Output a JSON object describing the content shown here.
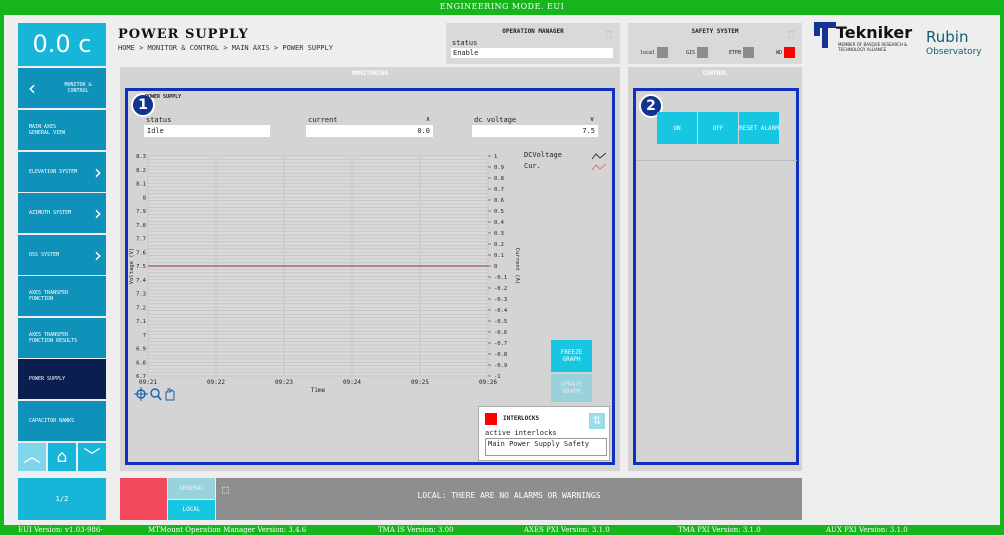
{
  "header_bar": "ENGINEERING MODE. EUI",
  "temperature": "0.0 c",
  "title": "POWER SUPPLY",
  "breadcrumb": "HOME > MONITOR & CONTROL > MAIN AXIS > POWER SUPPLY",
  "operation_manager": {
    "title": "OPERATION MANAGER",
    "status_label": "status",
    "status_value": "Enable"
  },
  "safety_system": {
    "title": "SAFETY SYSTEM",
    "local": "local",
    "gis": "GIS",
    "etpb": "ETPB",
    "wd": "WD"
  },
  "logo": {
    "tekniker": "Tekniker",
    "tekniker_sub": "MEMBER OF BASQUE RESEARCH & TECHNOLOGY ALLIANCE",
    "rubin": "Rubin",
    "observatory": "Observatory"
  },
  "sidebar": {
    "back_label": "MONITOR & CONTROL",
    "items": [
      {
        "label": "MAIN AXES GENERAL VIEW",
        "chevron": false
      },
      {
        "label": "ELEVATION SYSTEM",
        "chevron": true
      },
      {
        "label": "AZIMUTH SYSTEM",
        "chevron": true
      },
      {
        "label": "OSS SYSTEM",
        "chevron": true
      },
      {
        "label": "AXES TRANSFER FUNCTION",
        "chevron": false
      },
      {
        "label": "AXES TRANSFER FUNCTION RESULTS",
        "chevron": false
      },
      {
        "label": "POWER SUPPLY",
        "chevron": false,
        "active": true
      },
      {
        "label": "CAPACITOR BANKS",
        "chevron": false
      }
    ],
    "page": "1/2"
  },
  "monitoring": {
    "title": "MONITORING",
    "badge": "1",
    "panel_title": "POWER SUPPLY",
    "status_label": "status",
    "status_value": "Idle",
    "current_label": "current",
    "current_value": "0.0",
    "voltage_label": "dc voltage",
    "voltage_value": "7.5",
    "freeze_label": "FREEZE GRAPH",
    "update_label": "UPDATE GRAPH"
  },
  "interlocks": {
    "title": "INTERLOCKS",
    "active_label": "active interlocks",
    "value": "Main Power Supply Safety"
  },
  "control": {
    "title": "CONTROL",
    "badge": "2",
    "on": "ON",
    "off": "OFF",
    "reset": "RESET ALARM"
  },
  "footer": {
    "general": "GENERAL",
    "local": "LOCAL",
    "message": "LOCAL: THERE ARE NO ALARMS OR WARNINGS"
  },
  "versions": {
    "eui": "EUI Version: v1.03-986-",
    "mtmount": "MTMount Operation Manager Version: 3.4.6",
    "tma_is": "TMA IS Version: 3.00",
    "axes_pxi": "AXES PXI Version: 3.1.0",
    "tma_pxi": "TMA PXI Version: 3.1.0",
    "aux_pxi": "AUX PXI Version: 3.1.0"
  },
  "chart_data": {
    "type": "line",
    "xlabel": "Time",
    "ylabel": "Voltage (V)",
    "y2label": "Current (A)",
    "x_ticks": [
      "09:21",
      "09:22",
      "09:23",
      "09:24",
      "09:25",
      "09:26"
    ],
    "y_ticks": [
      "8.3",
      "8.2",
      "8.1",
      "8",
      "7.9",
      "7.8",
      "7.7",
      "7.6",
      "7.5",
      "7.4",
      "7.3",
      "7.2",
      "7.1",
      "7",
      "6.9",
      "6.8",
      "6.7"
    ],
    "y2_ticks": [
      "1",
      "0.9",
      "0.8",
      "0.7",
      "0.6",
      "0.5",
      "0.4",
      "0.3",
      "0.2",
      "0.1",
      "0",
      "-0.1",
      "-0.2",
      "-0.3",
      "-0.4",
      "-0.5",
      "-0.6",
      "-0.7",
      "-0.8",
      "-0.9",
      "-1"
    ],
    "ylim": [
      6.7,
      8.3
    ],
    "y2lim": [
      -1,
      1
    ],
    "series": [
      {
        "name": "DCVoltage",
        "color": "#333333",
        "values": [
          7.5,
          7.5
        ]
      },
      {
        "name": "Cur.",
        "color": "#e07070",
        "values": [
          0,
          0
        ]
      }
    ]
  }
}
